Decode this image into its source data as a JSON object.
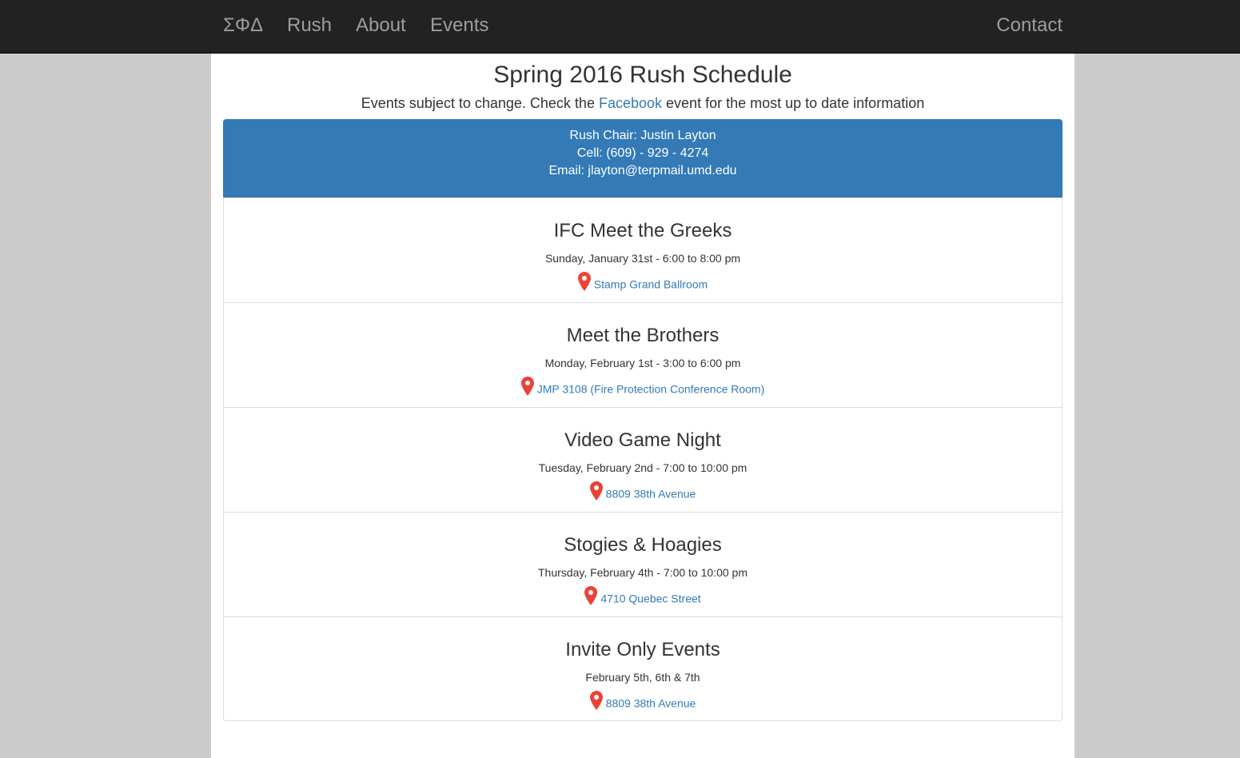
{
  "nav": {
    "brand": "ΣΦΔ",
    "items": [
      "Rush",
      "About",
      "Events"
    ],
    "contact": "Contact"
  },
  "header": {
    "title": "Spring 2016 Rush Schedule",
    "subtitle_before": "Events subject to change. Check the ",
    "subtitle_link": "Facebook",
    "subtitle_after": " event for the most up to date information"
  },
  "chair": {
    "name_line": "Rush Chair: Justin Layton",
    "cell_line": "Cell: (609) - 929 - 4274",
    "email_line": "Email: jlayton@terpmail.umd.edu"
  },
  "events": [
    {
      "name": "IFC Meet the Greeks",
      "time": "Sunday, January 31st - 6:00 to 8:00 pm",
      "location": "Stamp Grand Ballroom"
    },
    {
      "name": "Meet the Brothers",
      "time": "Monday, February 1st - 3:00 to 6:00 pm",
      "location": "JMP 3108 (Fire Protection Conference Room)"
    },
    {
      "name": "Video Game Night",
      "time": "Tuesday, February 2nd - 7:00 to 10:00 pm",
      "location": "8809 38th Avenue"
    },
    {
      "name": "Stogies & Hoagies",
      "time": "Thursday, February 4th - 7:00 to 10:00 pm",
      "location": "4710 Quebec Street"
    },
    {
      "name": "Invite Only Events",
      "time": "February 5th, 6th & 7th",
      "location": "8809 38th Avenue"
    }
  ],
  "colors": {
    "navbar_bg": "#222222",
    "nav_text": "#9d9d9d",
    "panel_heading_bg": "#337ab7",
    "link": "#337ab7",
    "pin": "#ea4335",
    "page_bg": "#cccccc"
  },
  "icons": {
    "location": "map-pin-icon"
  }
}
